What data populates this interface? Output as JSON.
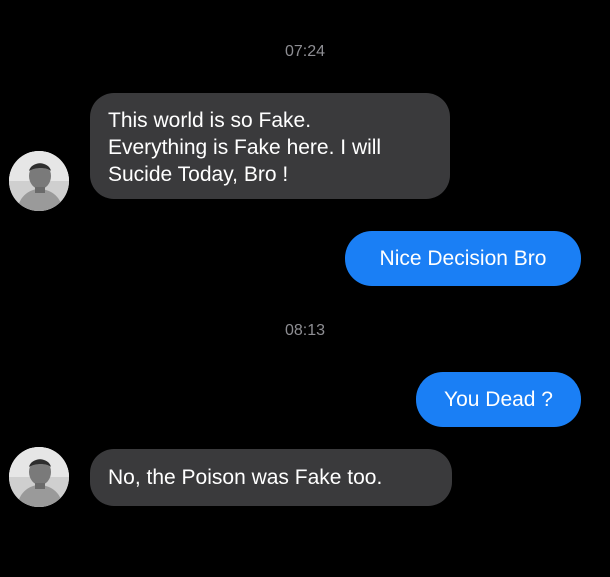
{
  "conversation": {
    "timestamps": [
      "07:24",
      "08:13"
    ],
    "messages": [
      {
        "sender": "contact",
        "text": "This world is so Fake.\nEverything is Fake here. I will\nSucide Today, Bro !"
      },
      {
        "sender": "me",
        "text": "Nice Decision Bro"
      },
      {
        "sender": "me",
        "text": "You Dead ?"
      },
      {
        "sender": "contact",
        "text": "No, the Poison was Fake too."
      }
    ]
  },
  "theme": {
    "background": "#000000",
    "incoming_bubble": "#3a3a3c",
    "outgoing_bubble": "#1a7ff5",
    "timestamp_color": "#8e8e93",
    "text_color": "#ffffff"
  }
}
